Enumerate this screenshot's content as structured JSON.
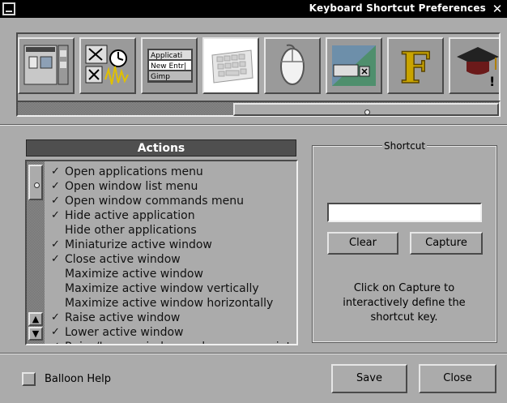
{
  "window": {
    "title": "Keyboard Shortcut Preferences"
  },
  "sections": {
    "items": [
      {
        "icon": "windows-preferences-icon"
      },
      {
        "icon": "window-handling-icon"
      },
      {
        "icon": "application-list-icon"
      },
      {
        "icon": "keyboard-icon"
      },
      {
        "icon": "mouse-icon"
      },
      {
        "icon": "workspace-icon"
      },
      {
        "icon": "font-icon"
      },
      {
        "icon": "expert-icon"
      }
    ],
    "selected_index": 3
  },
  "actions": {
    "header": "Actions",
    "items": [
      {
        "label": "Open applications menu",
        "checked": true
      },
      {
        "label": "Open window list menu",
        "checked": true
      },
      {
        "label": "Open window commands menu",
        "checked": true
      },
      {
        "label": "Hide active application",
        "checked": true
      },
      {
        "label": "Hide other applications",
        "checked": false
      },
      {
        "label": "Miniaturize active window",
        "checked": true
      },
      {
        "label": "Close active window",
        "checked": true
      },
      {
        "label": "Maximize active window",
        "checked": false
      },
      {
        "label": "Maximize active window vertically",
        "checked": false
      },
      {
        "label": "Maximize active window horizontally",
        "checked": false
      },
      {
        "label": "Raise active window",
        "checked": true
      },
      {
        "label": "Lower active window",
        "checked": true
      },
      {
        "label": "Raise/Lower window under mouse pointer",
        "checked": true
      }
    ],
    "check_glyph": "✓"
  },
  "shortcut": {
    "title": "Shortcut",
    "value": "",
    "clear_label": "Clear",
    "capture_label": "Capture",
    "hint": "Click on Capture to interactively define the shortcut key."
  },
  "footer": {
    "balloon_help_label": "Balloon Help",
    "balloon_help_checked": false,
    "save_label": "Save",
    "close_label": "Close"
  },
  "colors": {
    "window_bg": "#ababab",
    "titlebar_bg": "#000000",
    "header_bg": "#4f4f4f",
    "selected_tile_bg": "#ffffff"
  }
}
